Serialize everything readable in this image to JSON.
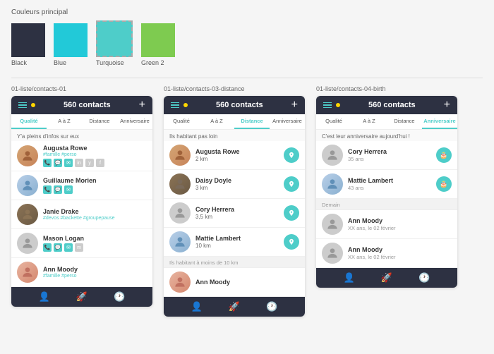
{
  "colorSection": {
    "title": "Couleurs principal",
    "swatches": [
      {
        "id": "black",
        "label": "Black",
        "class": "swatch-black"
      },
      {
        "id": "blue",
        "label": "Blue",
        "class": "swatch-blue"
      },
      {
        "id": "turquoise",
        "label": "Turquoise",
        "class": "swatch-turquoise"
      },
      {
        "id": "green2",
        "label": "Green 2",
        "class": "swatch-green"
      }
    ]
  },
  "mockups": [
    {
      "id": "mockup-01",
      "label": "01-liste/contacts-01",
      "header": {
        "title": "560 contacts"
      },
      "tabs": [
        "Qualité",
        "A à Z",
        "Distance",
        "Anniversaire"
      ],
      "activeTab": 0,
      "sectionHint": "Y'a pleins d'infos sur eux",
      "contacts": [
        {
          "name": "Augusta Rowe",
          "tags": "#famille #perso",
          "avatarClass": "avatar-img-1",
          "icons": [
            "phone",
            "chat",
            "email",
            "in",
            "y",
            "f"
          ],
          "showBirthday": false,
          "showDistance": false,
          "showLocationBtn": false,
          "showBirthdayBtn": false
        },
        {
          "name": "Guillaume Morien",
          "tags": "",
          "avatarClass": "avatar-img-2",
          "icons": [
            "phone",
            "chat",
            "email"
          ],
          "showBirthday": false,
          "showDistance": false,
          "showLocationBtn": false,
          "showBirthdayBtn": false
        },
        {
          "name": "Janie Drake",
          "tags": "#devos #backette #groupepause",
          "avatarClass": "avatar-img-3",
          "icons": [],
          "showBirthday": false,
          "showDistance": false,
          "showLocationBtn": false,
          "showBirthdayBtn": false
        },
        {
          "name": "Mason Logan",
          "tags": "",
          "avatarClass": "avatar-img-4",
          "icons": [
            "phone",
            "chat",
            "email",
            "m"
          ],
          "showBirthday": false,
          "showDistance": false,
          "showLocationBtn": false,
          "showBirthdayBtn": false
        },
        {
          "name": "Ann Moody",
          "tags": "#famille #perso",
          "avatarClass": "avatar-img-5",
          "icons": [],
          "showBirthday": false,
          "showDistance": false,
          "showLocationBtn": false,
          "showBirthdayBtn": false
        }
      ]
    },
    {
      "id": "mockup-03",
      "label": "01-liste/contacts-03-distance",
      "header": {
        "title": "560 contacts"
      },
      "tabs": [
        "Qualité",
        "A à Z",
        "Distance",
        "Anniversaire"
      ],
      "activeTab": 2,
      "sectionHint": "Ils habitant pas loin",
      "contacts": [
        {
          "name": "Augusta Rowe",
          "tags": "",
          "avatarClass": "avatar-img-1",
          "distance": "2 km",
          "showLocationBtn": true,
          "showBirthdayBtn": false
        },
        {
          "name": "Daisy Doyle",
          "tags": "",
          "avatarClass": "avatar-img-3",
          "distance": "3 km",
          "showLocationBtn": true,
          "showBirthdayBtn": false
        },
        {
          "name": "Cory Herrera",
          "tags": "",
          "avatarClass": "avatar-img-4",
          "distance": "3,5 km",
          "showLocationBtn": true,
          "showBirthdayBtn": false
        },
        {
          "name": "Mattie Lambert",
          "tags": "",
          "avatarClass": "avatar-img-2",
          "distance": "10 km",
          "showLocationBtn": true,
          "showBirthdayBtn": false
        }
      ],
      "sectionHint2": "Ils habitant à moins de 10 km",
      "contacts2": [
        {
          "name": "Ann Moody",
          "tags": "",
          "avatarClass": "avatar-img-5",
          "distance": "",
          "showLocationBtn": false,
          "showBirthdayBtn": false
        }
      ]
    },
    {
      "id": "mockup-04",
      "label": "01-liste/contacts-04-birth",
      "header": {
        "title": "560 contacts"
      },
      "tabs": [
        "Qualité",
        "A à Z",
        "Distance",
        "Anniversaire"
      ],
      "activeTab": 3,
      "sectionHint": "C'est leur anniversaire aujourd'hui !",
      "contacts": [
        {
          "name": "Cory Herrera",
          "age": "35 ans",
          "avatarClass": "avatar-img-4",
          "showLocationBtn": false,
          "showBirthdayBtn": true
        },
        {
          "name": "Mattie Lambert",
          "age": "43 ans",
          "avatarClass": "avatar-img-2",
          "showLocationBtn": false,
          "showBirthdayBtn": true
        }
      ],
      "sectionHint2": "Demain",
      "contacts2": [
        {
          "name": "Ann Moody",
          "age": "XX ans, le 02 février",
          "avatarClass": "avatar-img-4",
          "showLocationBtn": false,
          "showBirthdayBtn": false
        },
        {
          "name": "Ann Moody",
          "age": "XX ans, le 02 février",
          "avatarClass": "avatar-img-4",
          "showLocationBtn": false,
          "showBirthdayBtn": false
        }
      ]
    }
  ],
  "bottomNav": {
    "icons": [
      "person",
      "rocket",
      "clock"
    ]
  }
}
